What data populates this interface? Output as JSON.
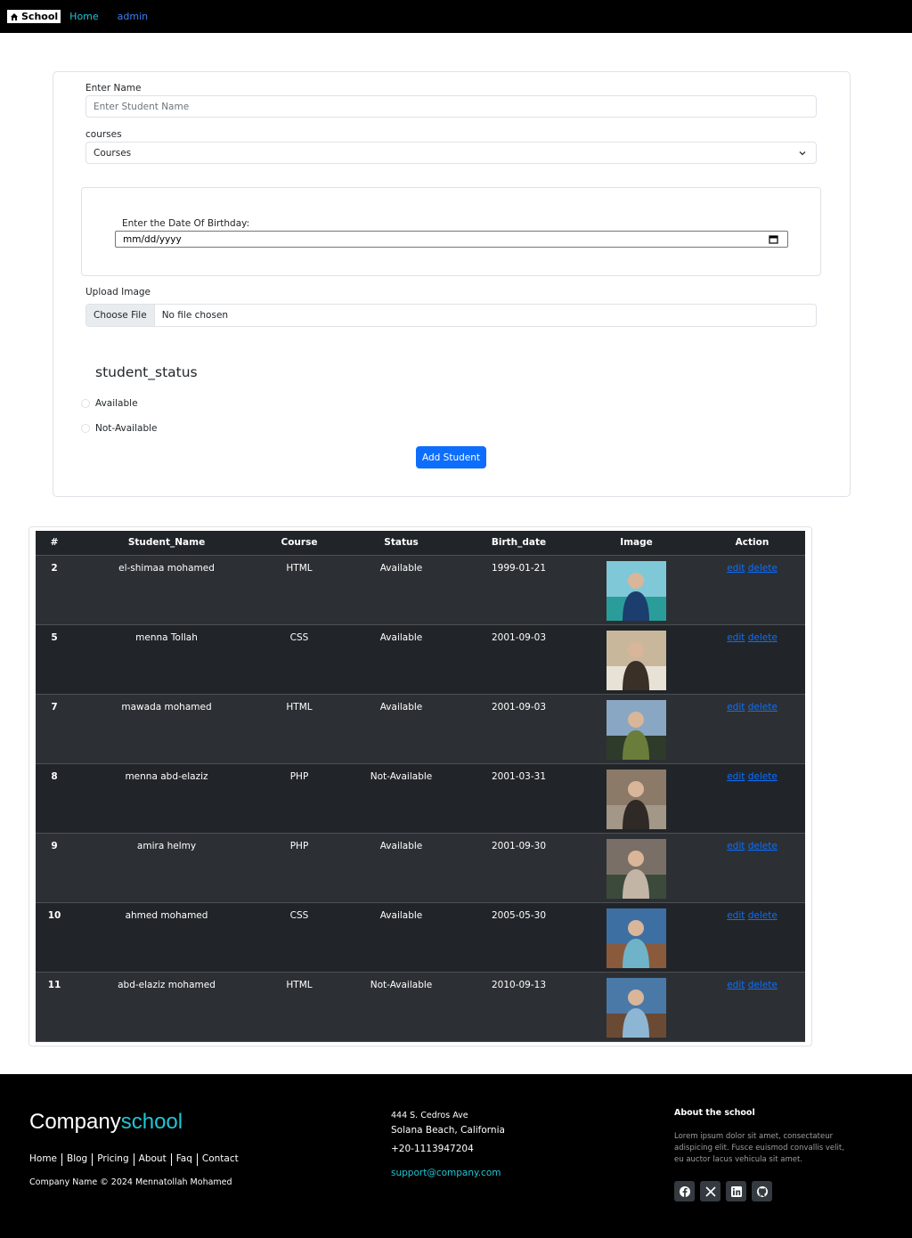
{
  "nav": {
    "brand": "School",
    "home": "Home",
    "admin": "admin"
  },
  "form": {
    "name_label": "Enter Name",
    "name_placeholder": "Enter Student Name",
    "courses_label": "courses",
    "courses_selected": "Courses",
    "dob_label": "Enter the Date Of Birthday:",
    "dob_placeholder": "mm/dd/yyyy",
    "upload_label": "Upload Image",
    "file_button": "Choose File",
    "file_status": "No file chosen",
    "status_title": "student_status",
    "status_options": [
      "Available",
      "Not-Available"
    ],
    "submit": "Add Student"
  },
  "table": {
    "headers": [
      "#",
      "Student_Name",
      "Course",
      "Status",
      "Birth_date",
      "Image",
      "Action"
    ],
    "edit_label": "edit",
    "delete_label": "delete",
    "rows": [
      {
        "id": "2",
        "name": "el-shimaa mohamed",
        "course": "HTML",
        "status": "Available",
        "birth": "1999-01-21"
      },
      {
        "id": "5",
        "name": "menna Tollah",
        "course": "CSS",
        "status": "Available",
        "birth": "2001-09-03"
      },
      {
        "id": "7",
        "name": "mawada mohamed",
        "course": "HTML",
        "status": "Available",
        "birth": "2001-09-03"
      },
      {
        "id": "8",
        "name": "menna abd-elaziz",
        "course": "PHP",
        "status": "Not-Available",
        "birth": "2001-03-31"
      },
      {
        "id": "9",
        "name": "amira helmy",
        "course": "PHP",
        "status": "Available",
        "birth": "2001-09-30"
      },
      {
        "id": "10",
        "name": "ahmed mohamed",
        "course": "CSS",
        "status": "Available",
        "birth": "2005-05-30"
      },
      {
        "id": "11",
        "name": "abd-elaziz mohamed",
        "course": "HTML",
        "status": "Not-Available",
        "birth": "2010-09-13"
      }
    ]
  },
  "footer": {
    "brand_a": "Company",
    "brand_b": "school",
    "links": [
      "Home",
      "Blog",
      "Pricing",
      "About",
      "Faq",
      "Contact"
    ],
    "copyright": "Company Name © 2024 Mennatollah Mohamed",
    "address1": "444 S. Cedros Ave",
    "address2": "Solana Beach, California",
    "phone": "+20-1113947204",
    "email": "support@company.com",
    "about_title": "About the school",
    "about_text": "Lorem ipsum dolor sit amet, consectateur adispicing elit. Fusce euismod convallis velit, eu auctor lacus vehicula sit amet.",
    "socials": [
      "facebook-icon",
      "x-icon",
      "linkedin-icon",
      "github-icon"
    ]
  }
}
